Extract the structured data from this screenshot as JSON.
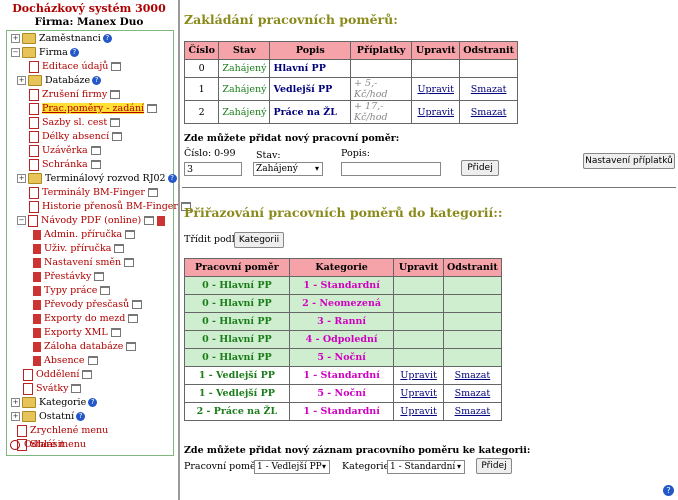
{
  "app": {
    "title": "Docházkový systém 3000",
    "firm": "Firma: Manex Duo"
  },
  "tree": {
    "zamestnanci": "Zaměstnanci",
    "firma": "Firma",
    "editace": "Editace údajů",
    "databaze": "Databáze",
    "zruseni": "Zrušení firmy",
    "pracpomery": "Prac.poměry - zadání",
    "sazby": "Sazby sl. cest",
    "delky": "Délky absencí",
    "uzaverka": "Uzávěrka",
    "schranka": "Schránka",
    "terminalovy": "Terminálový rozvod RJ02",
    "terminaly": "Terminály BM-Finger",
    "historie": "Historie přenosů BM-Finger",
    "navody": "Návody PDF (online)",
    "admin": "Admin. příručka",
    "uziv": "Uživ. příručka",
    "nastaveni_smen": "Nastavení směn",
    "prestavky": "Přestávky",
    "typy": "Typy práce",
    "prevody": "Převody přesčasů",
    "exporty_mezd": "Exporty do mezd",
    "exporty_xml": "Exporty XML",
    "zaloha": "Záloha databáze",
    "absence": "Absence",
    "oddeleni": "Oddělení",
    "svatky": "Svátky",
    "kategorie": "Kategorie",
    "ostatni": "Ostatní",
    "zrychlene": "Zrychlené menu",
    "stare": "Staré menu",
    "odhlasit": "Odhlásit"
  },
  "section1": {
    "title": "Zakládání pracovních poměrů:",
    "headers": [
      "Číslo",
      "Stav",
      "Popis",
      "Příplatky",
      "Upravit",
      "Odstranit"
    ],
    "rows": [
      {
        "num": "0",
        "stav": "Zahájený",
        "popis": "Hlavní PP",
        "priplatky": "",
        "upravit": "",
        "odstranit": ""
      },
      {
        "num": "1",
        "stav": "Zahájený",
        "popis": "Vedlejší PP",
        "priplatky": "+ 5,- Kč/hod",
        "upravit": "Upravit",
        "odstranit": "Smazat"
      },
      {
        "num": "2",
        "stav": "Zahájený",
        "popis": "Práce na ŽL",
        "priplatky": "+ 17,- Kč/hod",
        "upravit": "Upravit",
        "odstranit": "Smazat"
      }
    ],
    "add_title": "Zde můžete přidat nový pracovní poměr:",
    "cislo_label": "Číslo: 0-99",
    "cislo_value": "3",
    "stav_label": "Stav:",
    "stav_value": "Zahájený",
    "popis_label": "Popis:",
    "popis_value": "",
    "add_button": "Přidej",
    "priplatky_button": "Nastavení příplatků"
  },
  "section2": {
    "title": "Přiřazování pracovních poměrů do kategorií::",
    "sort_label": "Třídit podle",
    "sort_button": "Kategorii",
    "headers": [
      "Pracovní poměr",
      "Kategorie",
      "Upravit",
      "Odstranit"
    ],
    "rows": [
      {
        "pomer": "0 - Hlavní PP",
        "kategorie": "1 - Standardní",
        "upravit": "",
        "odstranit": ""
      },
      {
        "pomer": "0 - Hlavní PP",
        "kategorie": "2 - Neomezená",
        "upravit": "",
        "odstranit": ""
      },
      {
        "pomer": "0 - Hlavní PP",
        "kategorie": "3 - Ranní",
        "upravit": "",
        "odstranit": ""
      },
      {
        "pomer": "0 - Hlavní PP",
        "kategorie": "4 - Odpolední",
        "upravit": "",
        "odstranit": ""
      },
      {
        "pomer": "0 - Hlavní PP",
        "kategorie": "5 - Noční",
        "upravit": "",
        "odstranit": ""
      },
      {
        "pomer": "1 - Vedlejší PP",
        "kategorie": "1 - Standardní",
        "upravit": "Upravit",
        "odstranit": "Smazat"
      },
      {
        "pomer": "1 - Vedlejší PP",
        "kategorie": "5 - Noční",
        "upravit": "Upravit",
        "odstranit": "Smazat"
      },
      {
        "pomer": "2 - Práce na ŽL",
        "kategorie": "1 - Standardní",
        "upravit": "Upravit",
        "odstranit": "Smazat"
      }
    ],
    "add_title": "Zde můžete přidat nový záznam pracovního poměru ke kategorii:",
    "pomer_label": "Pracovní poměr:",
    "pomer_value": "1 - Vedlejší PP",
    "kategorie_label": "Kategorie:",
    "kategorie_value": "1 - Standardní",
    "add_button": "Přidej"
  },
  "colors": {
    "header_bg": "#f5a3a8",
    "green_row": "#cfeecf",
    "title": "#8a8a1a",
    "accent_red": "#b00000"
  }
}
